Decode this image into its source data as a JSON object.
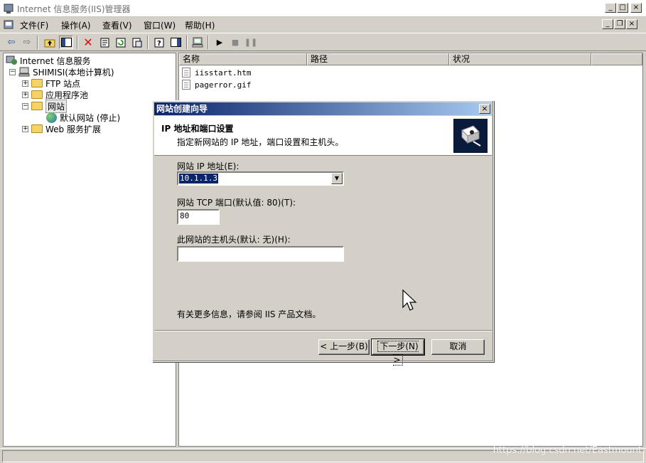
{
  "window": {
    "title": "Internet 信息服务(IIS)管理器",
    "buttons": [
      "_",
      "□",
      "×"
    ]
  },
  "menu": {
    "items": [
      "文件(F)",
      "操作(A)",
      "查看(V)",
      "窗口(W)",
      "帮助(H)"
    ],
    "mdi_buttons": [
      "_",
      "❐",
      "×"
    ]
  },
  "toolbar": {
    "icons": [
      "back-icon",
      "forward-icon",
      "up-folder-icon",
      "show-tree-icon",
      "delete-icon",
      "properties-icon",
      "refresh-icon",
      "export-icon",
      "help-icon",
      "console-icon",
      "computer-icon",
      "play-icon",
      "stop-icon",
      "pause-icon"
    ]
  },
  "tree": {
    "root": "Internet 信息服务",
    "computer": "SHIMISI(本地计算机)",
    "items": [
      "FTP 站点",
      "应用程序池",
      "网站",
      "默认网站 (停止)",
      "Web 服务扩展"
    ],
    "expanders": [
      "−",
      "+",
      "+",
      "−",
      "+"
    ]
  },
  "list": {
    "columns": [
      "名称",
      "路径",
      "状况"
    ],
    "files": [
      "iisstart.htm",
      "pagerror.gif"
    ]
  },
  "dialog": {
    "title": "网站创建向导",
    "close": "×",
    "heading": "IP 地址和端口设置",
    "subheading": "指定新网站的 IP 地址，端口设置和主机头。",
    "ip_label": "网站 IP 地址(E):",
    "ip_value": "10.1.1.3",
    "port_label": "网站 TCP 端口(默认值: 80)(T):",
    "port_value": "80",
    "host_label": "此网站的主机头(默认: 无)(H):",
    "host_value": "",
    "info": "有关更多信息，请参阅 IIS 产品文档。",
    "back_button": "< 上一步(B)",
    "next_button": "下一步(N) >",
    "cancel_button": "取消"
  },
  "watermark": "https://blog.csdn.net/Eastmount"
}
